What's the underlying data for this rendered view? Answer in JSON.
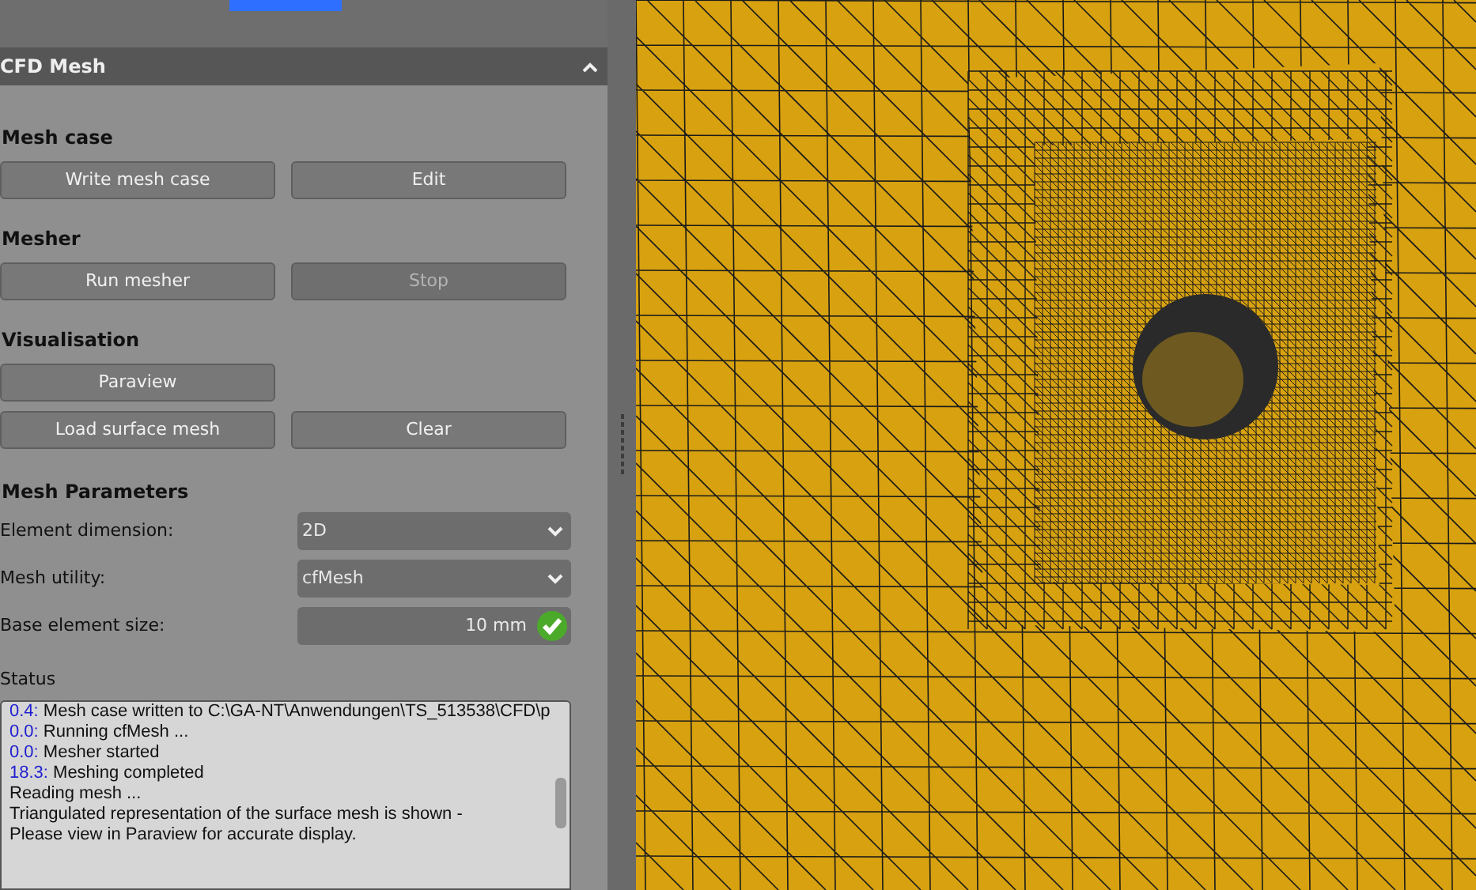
{
  "panel": {
    "title": "CFD Mesh",
    "expanded": true
  },
  "sections": [
    {
      "title": "Mesh case",
      "rows": [
        [
          {
            "label": "Write mesh case",
            "disabled": false
          },
          {
            "label": "Edit",
            "disabled": false
          }
        ]
      ]
    },
    {
      "title": "Mesher",
      "rows": [
        [
          {
            "label": "Run mesher",
            "disabled": false
          },
          {
            "label": "Stop",
            "disabled": true
          }
        ]
      ]
    },
    {
      "title": "Visualisation",
      "rows": [
        [
          {
            "label": "Paraview",
            "disabled": false
          }
        ],
        [
          {
            "label": "Load surface mesh",
            "disabled": false
          },
          {
            "label": "Clear",
            "disabled": false
          }
        ]
      ]
    }
  ],
  "parameters": {
    "title": "Mesh Parameters",
    "fields": [
      {
        "kind": "dropdown",
        "label": "Element dimension:",
        "value": "2D"
      },
      {
        "kind": "dropdown",
        "label": "Mesh utility:",
        "value": "cfMesh"
      },
      {
        "kind": "quantity",
        "label": "Base element size:",
        "value": "10 mm",
        "valid": true
      }
    ]
  },
  "status": {
    "title": "Status",
    "lines": [
      {
        "time": "0.4:",
        "text": "Mesh case written to C:\\GA-NT\\Anwendungen\\TS_513538\\CFD\\p"
      },
      {
        "time": "0.0:",
        "text": "Running cfMesh ..."
      },
      {
        "time": "0.0:",
        "text": "Mesher started"
      },
      {
        "time": "18.3:",
        "text": "Meshing completed"
      },
      {
        "text": "Reading mesh ..."
      },
      {
        "text": "Triangulated representation of the surface mesh is shown -"
      },
      {
        "text": "Please view in Paraview for accurate display."
      }
    ]
  }
}
